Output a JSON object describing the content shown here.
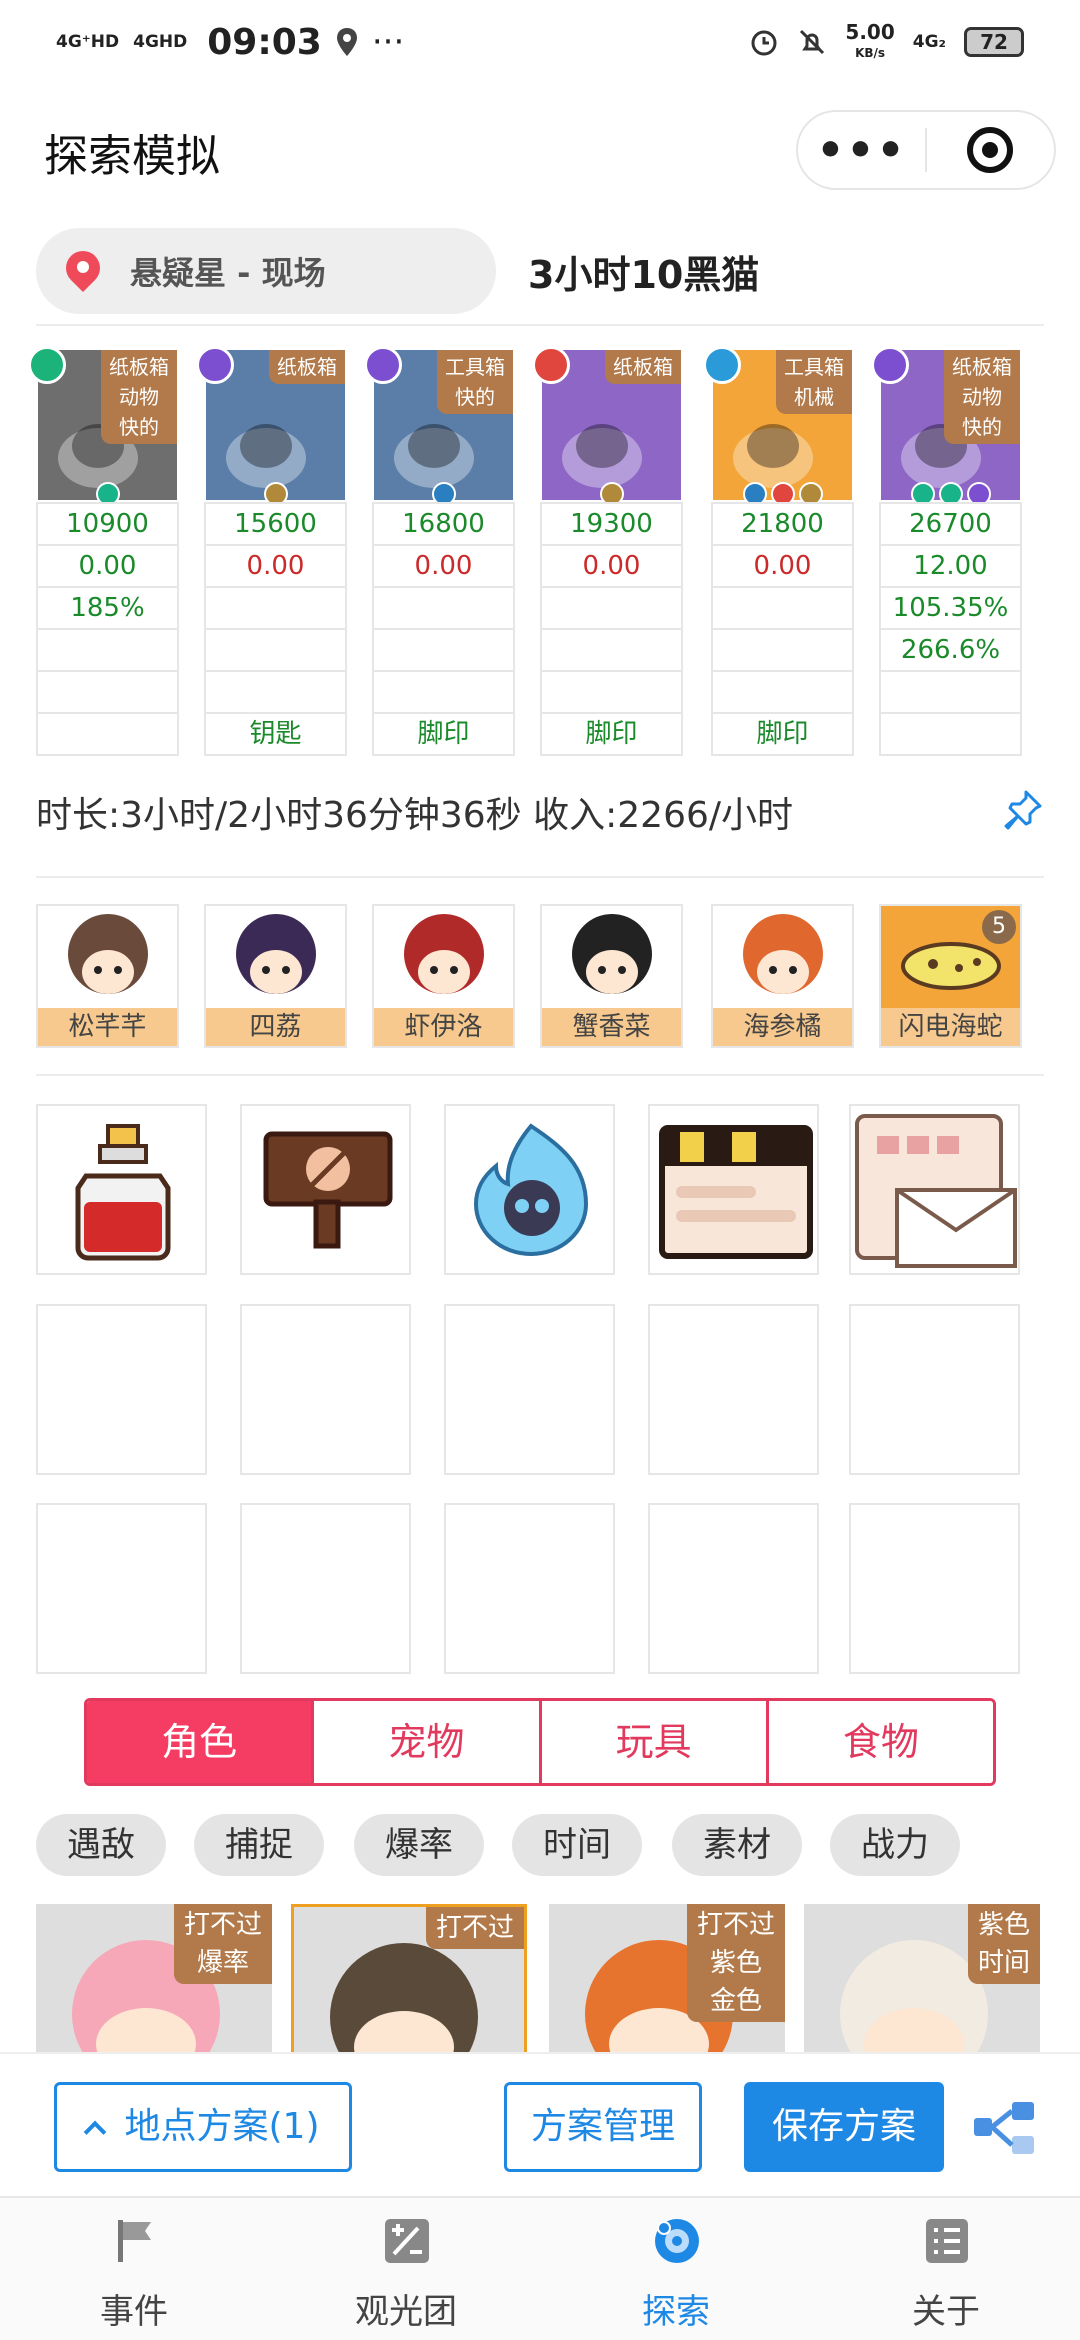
{
  "status_bar": {
    "network_1": "4G⁺HD",
    "network_2": "4GHD",
    "time": "09:03",
    "more": "···",
    "speed_value": "5.00",
    "speed_unit": "KB/s",
    "network_3": "4G₂",
    "battery": "72"
  },
  "header": {
    "title": "探索模拟",
    "menu_dots": "•••"
  },
  "location": {
    "place": "悬疑星 - 现场",
    "duration_title": "3小时10黑猫"
  },
  "items": [
    {
      "tags": [
        "纸板箱",
        "动物",
        "快的"
      ],
      "element": "green",
      "gems": [
        "#19b389"
      ],
      "rows": [
        "10900",
        "0.00",
        "185%",
        "",
        "",
        ""
      ],
      "row_colors": [
        "green",
        "green",
        "green",
        "",
        "",
        ""
      ]
    },
    {
      "tags": [
        "纸板箱"
      ],
      "element": "purple",
      "gems": [
        "#b08a3a"
      ],
      "rows": [
        "15600",
        "0.00",
        "",
        "",
        "",
        "钥匙"
      ],
      "row_colors": [
        "green",
        "red",
        "",
        "",
        "",
        "green"
      ]
    },
    {
      "tags": [
        "工具箱",
        "快的"
      ],
      "element": "purple",
      "gems": [
        "#2a7fc0"
      ],
      "rows": [
        "16800",
        "0.00",
        "",
        "",
        "",
        "脚印"
      ],
      "row_colors": [
        "green",
        "red",
        "",
        "",
        "",
        "green"
      ]
    },
    {
      "tags": [
        "纸板箱"
      ],
      "element": "red",
      "gems": [
        "#b08a3a"
      ],
      "rows": [
        "19300",
        "0.00",
        "",
        "",
        "",
        "脚印"
      ],
      "row_colors": [
        "green",
        "red",
        "",
        "",
        "",
        "green"
      ]
    },
    {
      "tags": [
        "工具箱",
        "机械"
      ],
      "element": "blue",
      "gems": [
        "#2a7fc0",
        "#e0463e",
        "#b08a3a"
      ],
      "rows": [
        "21800",
        "0.00",
        "",
        "",
        "",
        "脚印"
      ],
      "row_colors": [
        "green",
        "red",
        "",
        "",
        "",
        "green"
      ]
    },
    {
      "tags": [
        "纸板箱",
        "动物",
        "快的"
      ],
      "element": "purple",
      "gems": [
        "#19b389",
        "#19b389",
        "#7c4fd0"
      ],
      "rows": [
        "26700",
        "12.00",
        "105.35%",
        "266.6%",
        "",
        ""
      ],
      "row_colors": [
        "green",
        "green",
        "green",
        "green",
        "",
        ""
      ]
    }
  ],
  "summary": "时长:3小时/2小时36分钟36秒 收入:2266/小时",
  "characters": [
    {
      "name": "松芊芊"
    },
    {
      "name": "四荔"
    },
    {
      "name": "虾伊洛"
    },
    {
      "name": "蟹香菜"
    },
    {
      "name": "海参橘"
    },
    {
      "name": "闪电海蛇",
      "count": "5"
    }
  ],
  "category_tabs": [
    "角色",
    "宠物",
    "玩具",
    "食物"
  ],
  "filters": [
    "遇敌",
    "捕捉",
    "爆率",
    "时间",
    "素材",
    "战力"
  ],
  "result_cards": [
    {
      "tags": [
        "打不过",
        "爆率"
      ]
    },
    {
      "tags": [
        "打不过"
      ]
    },
    {
      "tags": [
        "打不过",
        "紫色",
        "金色"
      ]
    },
    {
      "tags": [
        "紫色",
        "时间"
      ]
    }
  ],
  "actions": {
    "plan_location": "地点方案(1)",
    "plan_manage": "方案管理",
    "plan_save": "保存方案"
  },
  "tabbar": [
    {
      "label": "事件",
      "icon": "flag-icon"
    },
    {
      "label": "观光团",
      "icon": "edit-icon"
    },
    {
      "label": "探索",
      "icon": "explore-icon"
    },
    {
      "label": "关于",
      "icon": "list-icon"
    }
  ],
  "colors": {
    "accent_pink": "#f53d63",
    "accent_blue": "#1e88e5",
    "tag_brown": "#b27a4a",
    "name_bg": "#f7c98e"
  }
}
